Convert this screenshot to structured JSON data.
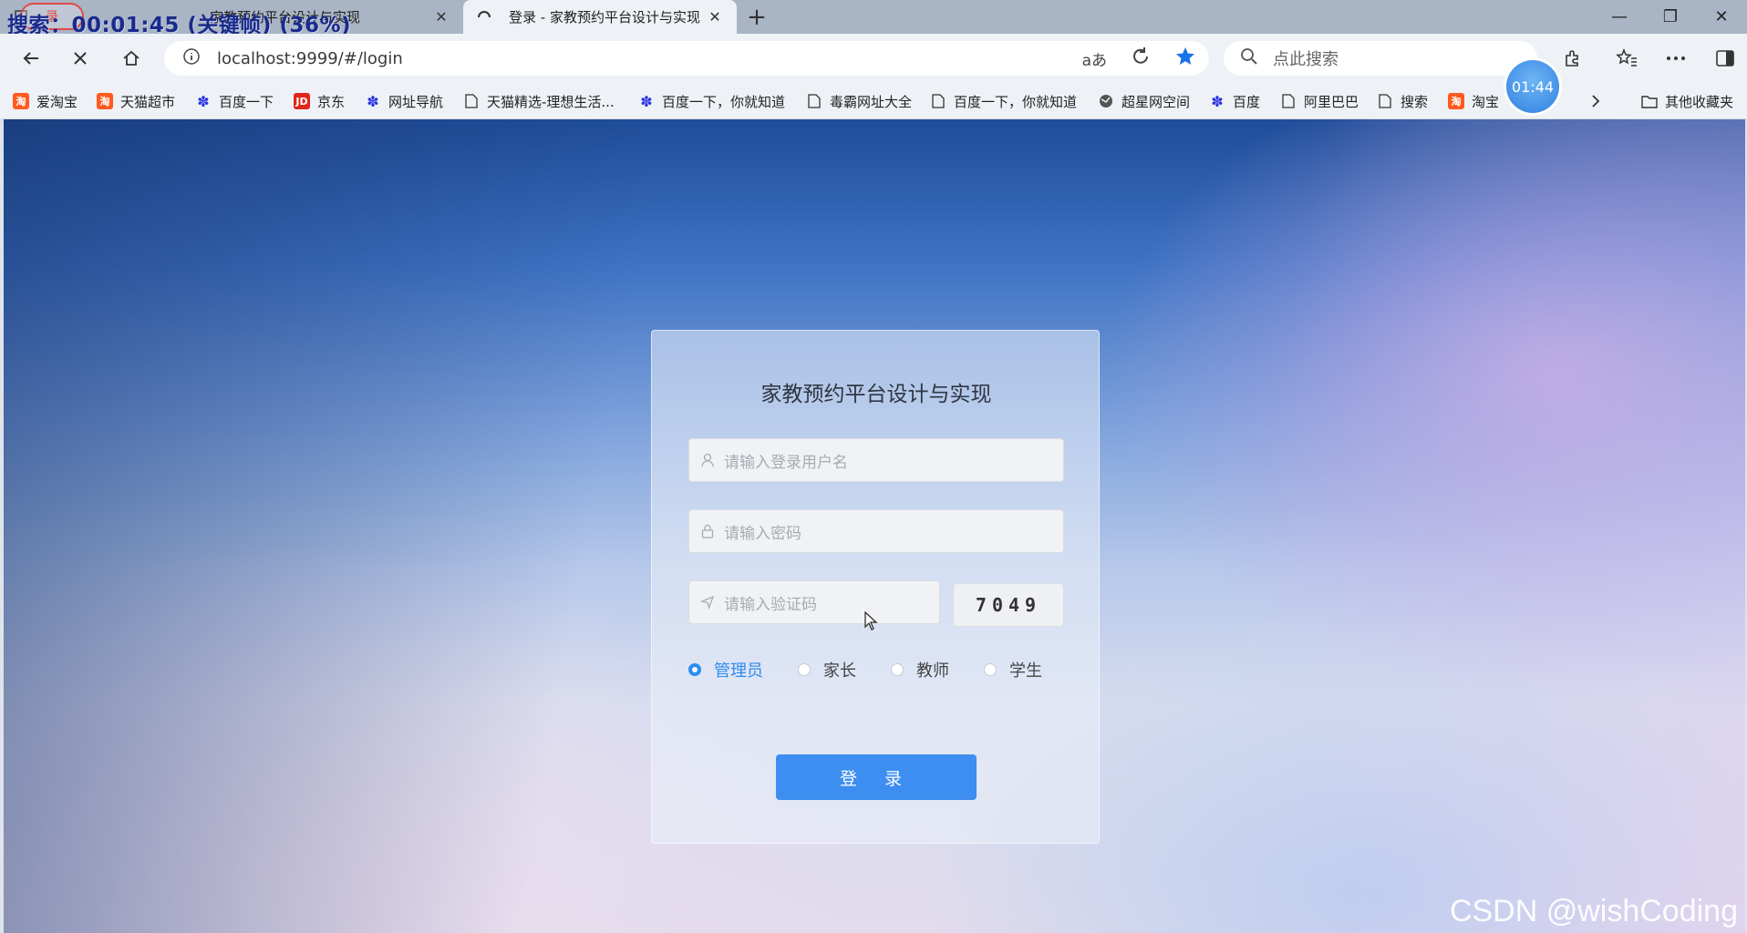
{
  "overlay": {
    "recording_text": "搜索：00:01:45 (关键帧) (36%)",
    "rec_badge": "录"
  },
  "tabs": [
    {
      "title": "家教预约平台设计与实现",
      "active": false
    },
    {
      "title": "登录 - 家教预约平台设计与实现",
      "active": true
    }
  ],
  "toolbar": {
    "url": "localhost:9999/#/login",
    "search_placeholder": "点此搜索"
  },
  "bookmarks": [
    {
      "label": "爱淘宝",
      "icon": "taobao-icon"
    },
    {
      "label": "天猫超市",
      "icon": "taobao-icon"
    },
    {
      "label": "百度一下",
      "icon": "baidu-icon"
    },
    {
      "label": "京东",
      "icon": "jd-icon"
    },
    {
      "label": "网址导航",
      "icon": "baidu-icon"
    },
    {
      "label": "天猫精选-理想生活...",
      "icon": "page-icon"
    },
    {
      "label": "百度一下，你就知道",
      "icon": "baidu-icon"
    },
    {
      "label": "毒霸网址大全",
      "icon": "page-icon"
    },
    {
      "label": "百度一下，你就知道",
      "icon": "page-icon"
    },
    {
      "label": "超星网空间",
      "icon": "globe-icon"
    },
    {
      "label": "百度",
      "icon": "baidu-icon"
    },
    {
      "label": "阿里巴巴",
      "icon": "page-icon"
    },
    {
      "label": "搜索",
      "icon": "page-icon"
    },
    {
      "label": "淘宝",
      "icon": "taobao-icon"
    }
  ],
  "other_bookmarks": "其他收藏夹",
  "timer": "01:44",
  "login": {
    "title": "家教预约平台设计与实现",
    "username_placeholder": "请输入登录用户名",
    "password_placeholder": "请输入密码",
    "captcha_placeholder": "请输入验证码",
    "captcha_code": "7049",
    "roles": [
      {
        "label": "管理员",
        "checked": true
      },
      {
        "label": "家长",
        "checked": false
      },
      {
        "label": "教师",
        "checked": false
      },
      {
        "label": "学生",
        "checked": false
      }
    ],
    "submit_label": "登 录"
  },
  "watermark": "CSDN @wishCoding",
  "colors": {
    "accent": "#3d8ef0",
    "radio_checked": "#2d8cf0",
    "star": "#1a73e8"
  }
}
